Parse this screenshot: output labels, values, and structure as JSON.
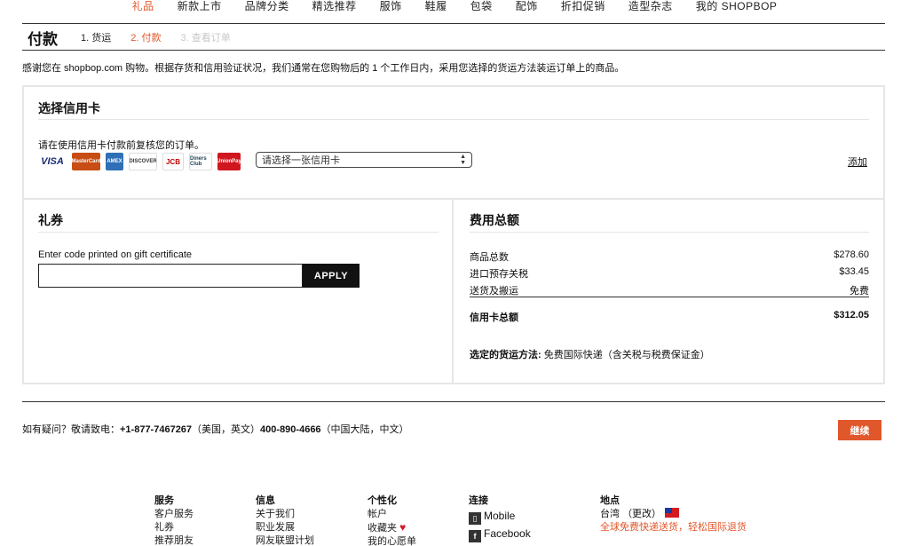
{
  "nav": {
    "items": [
      {
        "label": "礼品",
        "active": true
      },
      {
        "label": "新款上市",
        "active": false
      },
      {
        "label": "品牌分类",
        "active": false
      },
      {
        "label": "精选推荐",
        "active": false
      },
      {
        "label": "服饰",
        "active": false
      },
      {
        "label": "鞋履",
        "active": false
      },
      {
        "label": "包袋",
        "active": false
      },
      {
        "label": "配饰",
        "active": false
      },
      {
        "label": "折扣促销",
        "active": false
      },
      {
        "label": "造型杂志",
        "active": false
      },
      {
        "label": "我的 SHOPBOP",
        "active": false
      }
    ]
  },
  "checkout": {
    "title": "付款",
    "steps": [
      {
        "label": "1. 货运",
        "state": "done"
      },
      {
        "label": "2. 付款",
        "state": "current"
      },
      {
        "label": "3. 查看订单",
        "state": "future"
      }
    ],
    "intro": "感谢您在 shopbop.com 购物。根据存货和信用验证状况，我们通常在您购物后的 1 个工作日内，采用您选择的货运方法装运订单上的商品。"
  },
  "credit_card": {
    "title": "选择信用卡",
    "note": "请在使用信用卡付款前复核您的订单。",
    "cards": [
      "VISA",
      "MasterCard",
      "AMEX",
      "DISCOVER",
      "JCB",
      "Diners Club",
      "UnionPay"
    ],
    "select_placeholder": "请选择一张信用卡",
    "add_label": "添加"
  },
  "gift": {
    "title": "礼券",
    "label": "Enter code printed on gift certificate",
    "input_value": "",
    "apply_label": "APPLY"
  },
  "summary": {
    "title": "费用总额",
    "rows": [
      {
        "label": "商品总数",
        "value": "$278.60"
      },
      {
        "label": "进口预存关税",
        "value": "$33.45"
      },
      {
        "label": "送货及搬运",
        "value": "免费"
      }
    ],
    "total_label": "信用卡总额",
    "total_value": "$312.05",
    "ship_label": "选定的货运方法:",
    "ship_value": " 免费国际快递（含关税与税费保证金）"
  },
  "help": {
    "prefix": "如有疑问？敬请致电：",
    "phone1": "+1-877-7467267",
    "region1": "（美国，英文）",
    "phone2": "400-890-4666",
    "region2": "（中国大陆，中文）",
    "continue_label": "继续"
  },
  "footer": {
    "service": {
      "head": "服务",
      "items": [
        "客户服务",
        "礼券",
        "推荐朋友"
      ]
    },
    "info": {
      "head": "信息",
      "items": [
        "关于我们",
        "职业发展",
        "网友联盟计划"
      ]
    },
    "personal": {
      "head": "个性化",
      "items": [
        "帐户",
        "收藏夹",
        "我的心愿单"
      ]
    },
    "connect": {
      "head": "连接",
      "items": [
        "Mobile",
        "Facebook"
      ]
    },
    "location": {
      "head": "地点",
      "region": "台湾",
      "change": "（更改）",
      "promo": "全球免费快递送货，轻松国际退货"
    }
  },
  "colors": {
    "accent": "#e0572b",
    "text": "#111111",
    "border": "#e6e6e6"
  }
}
